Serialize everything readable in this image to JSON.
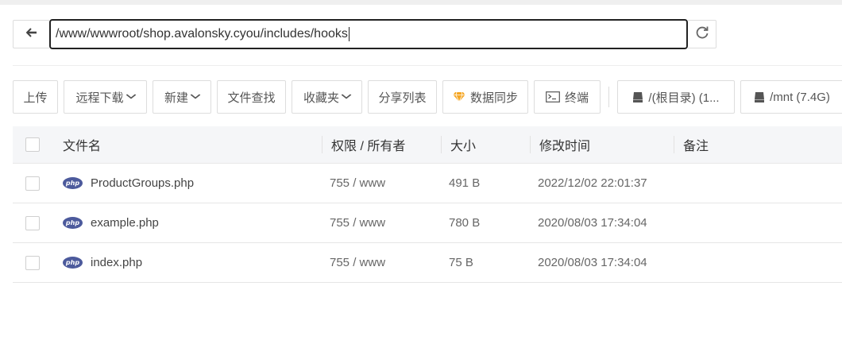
{
  "path_bar": {
    "current_path": "/www/wwwroot/shop.avalonsky.cyou/includes/hooks"
  },
  "toolbar": {
    "upload": "上传",
    "remote_download": "远程下载",
    "new": "新建",
    "file_search": "文件查找",
    "favorites": "收藏夹",
    "share_list": "分享列表",
    "data_sync": "数据同步",
    "terminal": "终端",
    "disk_root": "/(根目录) (1...",
    "disk_mnt": "/mnt (7.4G)"
  },
  "table": {
    "headers": {
      "name": "文件名",
      "permission": "权限 / 所有者",
      "size": "大小",
      "modified": "修改时间",
      "note": "备注"
    },
    "rows": [
      {
        "icon": "php-icon",
        "name": "ProductGroups.php",
        "permission": "755 / www",
        "size": "491 B",
        "modified": "2022/12/02 22:01:37",
        "note": ""
      },
      {
        "icon": "php-icon",
        "name": "example.php",
        "permission": "755 / www",
        "size": "780 B",
        "modified": "2020/08/03 17:34:04",
        "note": ""
      },
      {
        "icon": "php-icon",
        "name": "index.php",
        "permission": "755 / www",
        "size": "75 B",
        "modified": "2020/08/03 17:34:04",
        "note": ""
      }
    ]
  },
  "icons": {
    "php_label": "php"
  },
  "colors": {
    "path_border": "#222222",
    "php_badge": "#4c5a9c",
    "gem_orange": "#f5a623",
    "header_bg": "#f5f6f8"
  }
}
